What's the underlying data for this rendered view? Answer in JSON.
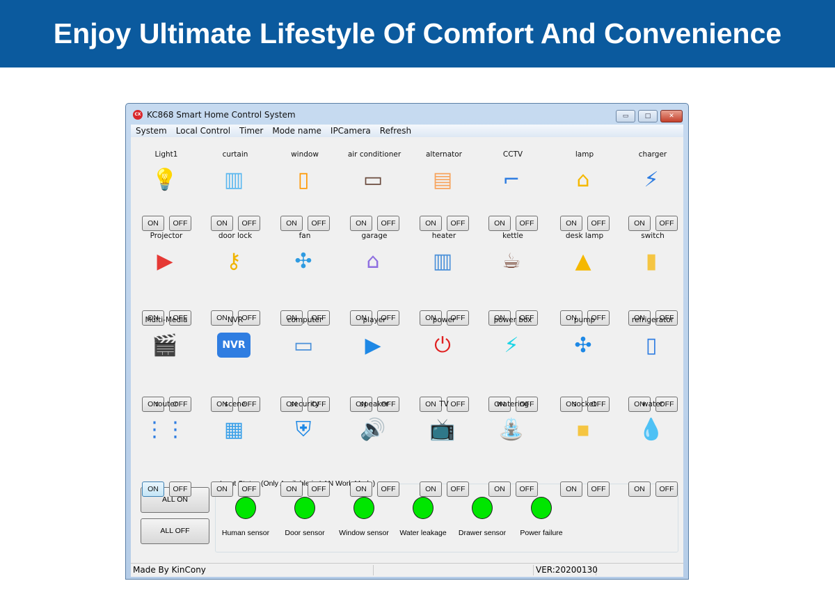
{
  "banner": {
    "title": "Enjoy Ultimate Lifestyle Of Comfort And Convenience"
  },
  "window": {
    "title": "KC868 Smart Home Control System",
    "app_icon": "CX",
    "minimize": "▭",
    "maximize": "□",
    "close": "✕"
  },
  "menu": [
    "System",
    "Local Control",
    "Timer",
    "Mode name",
    "IPCamera",
    "Refresh"
  ],
  "on_label": "ON",
  "off_label": "OFF",
  "devices": [
    {
      "label": "Light1",
      "icon": "lightbulb-icon",
      "glyph": "💡",
      "color": "#f5c542"
    },
    {
      "label": "curtain",
      "icon": "curtain-icon",
      "glyph": "▥",
      "color": "#5cb8ef"
    },
    {
      "label": "window",
      "icon": "window-icon",
      "glyph": "▯",
      "color": "#ff9800"
    },
    {
      "label": "air conditioner",
      "icon": "air-conditioner-icon",
      "glyph": "▭",
      "color": "#6b4b3e"
    },
    {
      "label": "alternator",
      "icon": "alternator-icon",
      "glyph": "▤",
      "color": "#f7a35c"
    },
    {
      "label": "CCTV",
      "icon": "cctv-icon",
      "glyph": "⌐",
      "color": "#2f7de1"
    },
    {
      "label": "lamp",
      "icon": "lamp-icon",
      "glyph": "⌂",
      "color": "#f5b800"
    },
    {
      "label": "charger",
      "icon": "charger-icon",
      "glyph": "⚡",
      "color": "#2f7de1"
    },
    {
      "label": "Projector",
      "icon": "projector-icon",
      "glyph": "▶",
      "color": "#e53935"
    },
    {
      "label": "door lock",
      "icon": "door-lock-icon",
      "glyph": "⚷",
      "color": "#f0b400"
    },
    {
      "label": "fan",
      "icon": "fan-icon",
      "glyph": "✣",
      "color": "#2f9be1"
    },
    {
      "label": "garage",
      "icon": "garage-icon",
      "glyph": "⌂",
      "color": "#8e6fe0"
    },
    {
      "label": "heater",
      "icon": "heater-icon",
      "glyph": "▥",
      "color": "#4a90d9"
    },
    {
      "label": "kettle",
      "icon": "kettle-icon",
      "glyph": "☕",
      "color": "#7a4a3a"
    },
    {
      "label": "desk lamp",
      "icon": "desk-lamp-icon",
      "glyph": "▲",
      "color": "#f5b800"
    },
    {
      "label": "switch",
      "icon": "switch-icon",
      "glyph": "▮",
      "color": "#f5c542"
    },
    {
      "label": "Multi-Media",
      "icon": "clapperboard-icon",
      "glyph": "🎬",
      "color": "#e53935"
    },
    {
      "label": "NVR",
      "icon": "nvr-icon",
      "glyph": "NVR",
      "color": "#2f7de1"
    },
    {
      "label": "computer",
      "icon": "computer-icon",
      "glyph": "▭",
      "color": "#4a90d9"
    },
    {
      "label": "player",
      "icon": "play-icon",
      "glyph": "▶",
      "color": "#1e88e5"
    },
    {
      "label": "power",
      "icon": "power-icon",
      "glyph": "⏻",
      "color": "#e02020"
    },
    {
      "label": "power box",
      "icon": "power-box-icon",
      "glyph": "⚡",
      "color": "#1ad4e6"
    },
    {
      "label": "pump",
      "icon": "pump-icon",
      "glyph": "✣",
      "color": "#1e88e5"
    },
    {
      "label": "refrigerator",
      "icon": "refrigerator-icon",
      "glyph": "▯",
      "color": "#2f7de1"
    },
    {
      "label": "router",
      "icon": "router-icon",
      "glyph": "⋮⋮",
      "color": "#2f7de1"
    },
    {
      "label": "scene",
      "icon": "scene-icon",
      "glyph": "▦",
      "color": "#3aa0e8"
    },
    {
      "label": "security",
      "icon": "shield-icon",
      "glyph": "⛨",
      "color": "#1e88e5"
    },
    {
      "label": "speaker",
      "icon": "speaker-icon",
      "glyph": "🔊",
      "color": "#f57c00"
    },
    {
      "label": "TV",
      "icon": "tv-icon",
      "glyph": "📺",
      "color": "#546e7a"
    },
    {
      "label": "watering",
      "icon": "watering-can-icon",
      "glyph": "⛲",
      "color": "#6a9a3a"
    },
    {
      "label": "socket",
      "icon": "socket-icon",
      "glyph": "▪",
      "color": "#f5c542"
    },
    {
      "label": "water",
      "icon": "water-drop-icon",
      "glyph": "💧",
      "color": "#f7a35c"
    }
  ],
  "all_on": "ALL ON",
  "all_off": "ALL OFF",
  "input_status": {
    "title": "Input Status (Only Available in LAN Work Mode)",
    "indicator_color": "#00e600",
    "sensors": [
      "Human sensor",
      "Door sensor",
      "Window sensor",
      "Water leakage",
      "Drawer sensor",
      "Power failure"
    ]
  },
  "statusbar": {
    "left": "Made By KinCony",
    "version": "VER:20200130"
  }
}
